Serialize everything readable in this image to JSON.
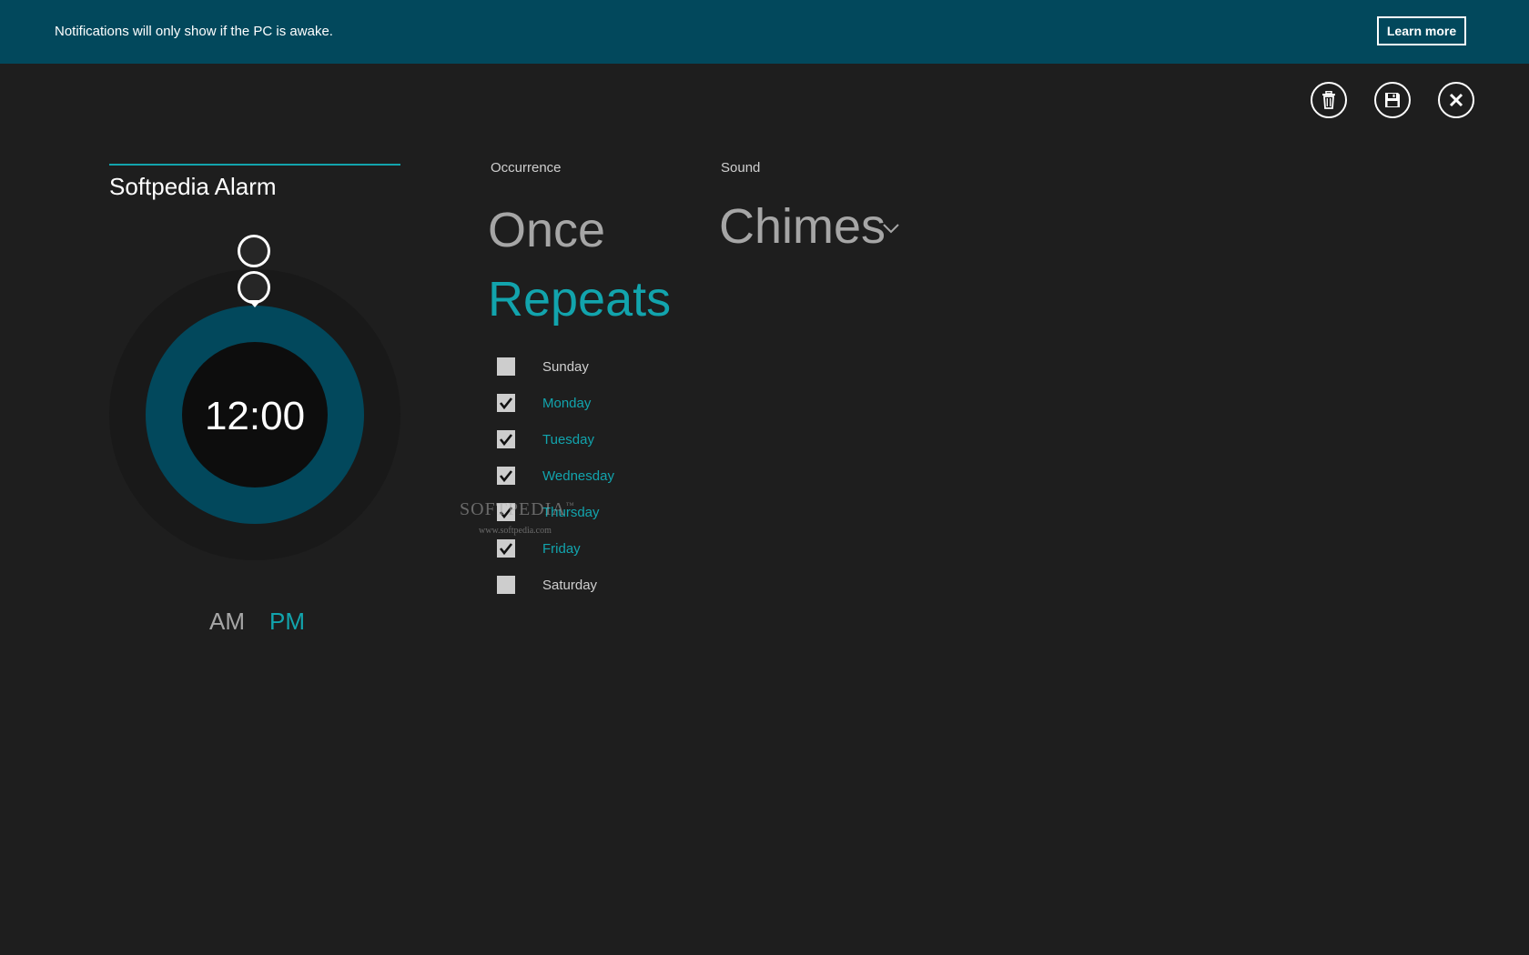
{
  "banner": {
    "message": "Notifications will only show if the PC is awake.",
    "learn_more_label": "Learn more",
    "color": "#02485c"
  },
  "commands": {
    "delete_icon": "trash-icon",
    "save_icon": "save-icon",
    "close_icon": "close-icon"
  },
  "alarm": {
    "name": "Softpedia Alarm",
    "time": "12:00",
    "am_label": "AM",
    "pm_label": "PM",
    "selected_period": "PM"
  },
  "occurrence": {
    "label": "Occurrence",
    "options": [
      "Once",
      "Repeats"
    ],
    "selected": "Repeats",
    "days": [
      {
        "label": "Sunday",
        "checked": false
      },
      {
        "label": "Monday",
        "checked": true
      },
      {
        "label": "Tuesday",
        "checked": true
      },
      {
        "label": "Wednesday",
        "checked": true
      },
      {
        "label": "Thursday",
        "checked": true
      },
      {
        "label": "Friday",
        "checked": true
      },
      {
        "label": "Saturday",
        "checked": false
      }
    ]
  },
  "sound": {
    "label": "Sound",
    "value": "Chimes"
  },
  "watermark": {
    "brand": "SOFTPEDIA",
    "trademark": "™",
    "url": "www.softpedia.com"
  },
  "colors": {
    "accent": "#12a4ad",
    "background": "#1e1e1e",
    "ring": "#02485c",
    "muted": "#a6a6a6"
  }
}
